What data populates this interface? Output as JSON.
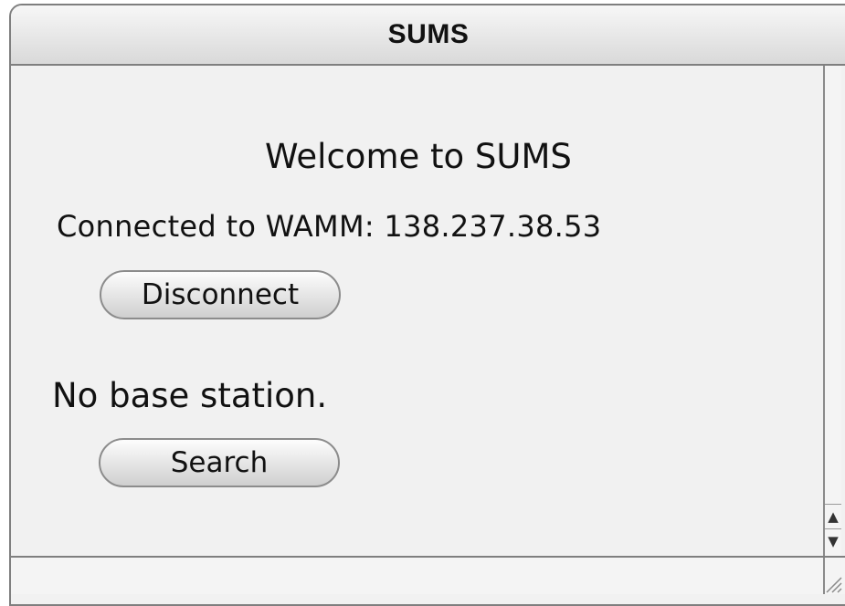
{
  "window": {
    "title": "SUMS"
  },
  "main": {
    "welcome": "Welcome to SUMS",
    "connection_status": "Connected to WAMM: 138.237.38.53",
    "disconnect_label": "Disconnect",
    "base_station_status": "No base station.",
    "search_label": "Search"
  },
  "icons": {
    "scroll_up": "scroll-up-arrow",
    "scroll_down": "scroll-down-arrow",
    "resize": "resize-grip"
  }
}
